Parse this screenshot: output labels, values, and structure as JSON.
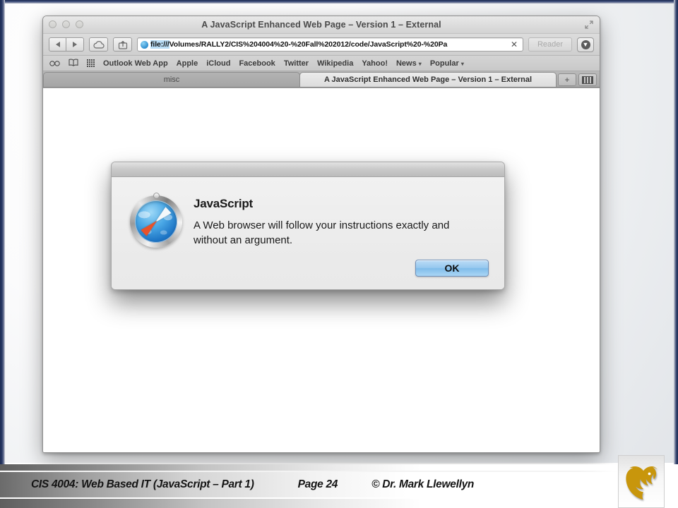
{
  "slide": {
    "footer": {
      "course": "CIS 4004: Web Based IT (JavaScript – Part 1)",
      "page": "Page 24",
      "copyright": "© Dr. Mark Llewellyn"
    },
    "logo_alt": "ucf-pegasus-logo",
    "logo_color": "#C8960C"
  },
  "browser": {
    "window_title": "A JavaScript Enhanced Web Page – Version 1 – External",
    "traffic_lights": [
      "close",
      "minimize",
      "zoom"
    ],
    "fullscreen_icon": "↗",
    "toolbar": {
      "back_icon": "back-arrow",
      "forward_icon": "forward-arrow",
      "icloud_icon": "cloud",
      "share_icon": "share-arrow",
      "url_scheme": "file:///",
      "url_path": "Volumes/RALLY2/CIS%204004%20-%20Fall%202012/code/JavaScript%20-%20Pa",
      "url_clear_icon": "✕",
      "reader_label": "Reader",
      "download_icon": "download-arrow"
    },
    "bookmarks": {
      "reading_list_icon": "glasses",
      "bookmarks_icon": "open-book",
      "top_sites_icon": "grid",
      "items": [
        {
          "label": "Outlook Web App",
          "has_menu": false
        },
        {
          "label": "Apple",
          "has_menu": false
        },
        {
          "label": "iCloud",
          "has_menu": false
        },
        {
          "label": "Facebook",
          "has_menu": false
        },
        {
          "label": "Twitter",
          "has_menu": false
        },
        {
          "label": "Wikipedia",
          "has_menu": false
        },
        {
          "label": "Yahoo!",
          "has_menu": false
        },
        {
          "label": "News",
          "has_menu": true
        },
        {
          "label": "Popular",
          "has_menu": true
        }
      ],
      "caret": "▾"
    },
    "tabs": [
      {
        "label": "misc",
        "active": false
      },
      {
        "label": "A JavaScript Enhanced Web Page – Version 1 – External",
        "active": true
      }
    ],
    "new_tab_label": "+",
    "tab_overview_icon": "tabs-overview"
  },
  "dialog": {
    "icon": "safari-compass-icon",
    "heading": "JavaScript",
    "message": "A Web browser will follow your instructions exactly and without an argument.",
    "ok_label": "OK",
    "accent_color": "#97c8ef"
  }
}
